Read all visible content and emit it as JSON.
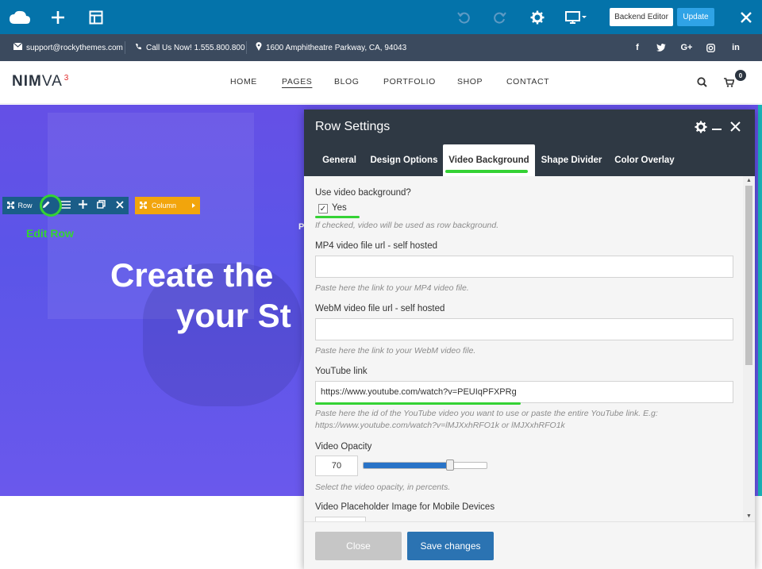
{
  "toolbar": {
    "backend_editor_label": "Backend Editor",
    "update_label": "Update",
    "icons": [
      "cloud-logo-icon",
      "plus-icon",
      "layout-icon",
      "undo-icon",
      "redo-icon",
      "gear-icon",
      "monitor-icon",
      "close-icon"
    ]
  },
  "info_bar": {
    "email": "support@rockythemes.com",
    "phone": "Call Us Now! 1.555.800.800",
    "address": "1600 Amphitheatre Parkway, CA, 94043",
    "social_icons": [
      "facebook-icon",
      "twitter-icon",
      "google-plus-icon",
      "instagram-icon",
      "linkedin-icon"
    ],
    "social": {
      "facebook": "f",
      "google": "G+",
      "linkedin": "in"
    }
  },
  "site_nav": {
    "logo_bold": "NIM",
    "logo_light": "VA",
    "logo_sup": "3",
    "links": [
      "HOME",
      "PAGES",
      "BLOG",
      "PORTFOLIO",
      "SHOP",
      "CONTACT"
    ],
    "active_link": "PAGES",
    "cart_count": "0"
  },
  "hero": {
    "line1": "Create the",
    "line2": "your St",
    "small_text": "P"
  },
  "row_controls": {
    "row_label": "Row",
    "column_label": "Column",
    "edit_row_annotation": "Edit Row"
  },
  "modal": {
    "title": "Row Settings",
    "tabs": [
      "General",
      "Design Options",
      "Video Background",
      "Shape Divider",
      "Color Overlay"
    ],
    "active_tab": "Video Background",
    "fields": {
      "use_video_label": "Use video background?",
      "use_video_checkbox": "Yes",
      "use_video_checked": true,
      "use_video_help": "If checked, video will be used as row background.",
      "mp4_label": "MP4 video file url - self hosted",
      "mp4_value": "",
      "mp4_help": "Paste here the link to your MP4 video file.",
      "webm_label": "WebM video file url - self hosted",
      "webm_value": "",
      "webm_help": "Paste here the link to your WebM video file.",
      "youtube_label": "YouTube link",
      "youtube_value": "https://www.youtube.com/watch?v=PEUIqPFXPRg",
      "youtube_help_1": "Paste here the id of the YouTube video you want to use or paste the entire YouTube link. E.g:",
      "youtube_help_2": "https://www.youtube.com/watch?v=lMJXxhRFO1k or lMJXxhRFO1k",
      "opacity_label": "Video Opacity",
      "opacity_value": "70",
      "opacity_help": "Select the video opacity, in percents.",
      "placeholder_label": "Video Placeholder Image for Mobile Devices"
    },
    "close_label": "Close",
    "save_label": "Save changes"
  },
  "colors": {
    "toolbar": "#0473aa",
    "info_bar": "#3b4a5e",
    "modal_header": "#2f3944",
    "highlight": "#35d235",
    "save_button": "#2b73b2",
    "column_control": "#f2a50c"
  }
}
